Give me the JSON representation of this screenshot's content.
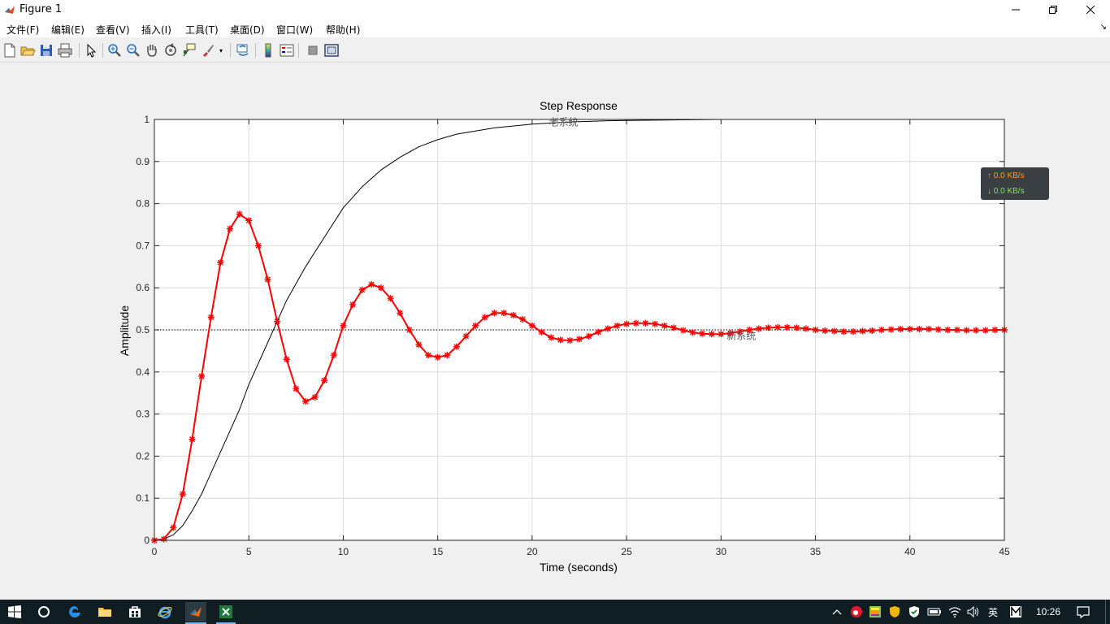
{
  "window": {
    "title": "Figure 1",
    "controls": {
      "minimize": "minimize-icon",
      "restore": "restore-icon",
      "close": "close-icon"
    }
  },
  "menu": {
    "items": [
      "文件(F)",
      "编辑(E)",
      "查看(V)",
      "插入(I)",
      "工具(T)",
      "桌面(D)",
      "窗口(W)",
      "帮助(H)"
    ]
  },
  "toolbar": {
    "icons": [
      "new-figure-icon",
      "open-file-icon",
      "save-icon",
      "print-icon",
      "pointer-icon",
      "zoom-in-icon",
      "zoom-out-icon",
      "pan-hand-icon",
      "rotate-3d-icon",
      "data-cursor-icon",
      "brush-icon",
      "link-plot-icon",
      "colorbar-icon",
      "legend-icon",
      "hide-plot-tools-icon",
      "show-plot-tools-icon"
    ]
  },
  "chart_data": {
    "type": "line",
    "title": "Step Response",
    "xlabel": "Time (seconds)",
    "ylabel": "Amplitude",
    "xlim": [
      0,
      45
    ],
    "ylim": [
      0,
      1
    ],
    "xticks": [
      0,
      5,
      10,
      15,
      20,
      25,
      30,
      35,
      40,
      45
    ],
    "yticks": [
      0,
      0.1,
      0.2,
      0.3,
      0.4,
      0.5,
      0.6,
      0.7,
      0.8,
      0.9,
      1
    ],
    "grid": true,
    "reference_lines": [
      1.0,
      0.5
    ],
    "series": [
      {
        "name": "老系统",
        "color": "#000000",
        "marker": "none",
        "x": [
          0,
          0.5,
          1,
          1.5,
          2,
          2.5,
          3,
          3.5,
          4,
          4.5,
          5,
          6,
          7,
          8,
          9,
          10,
          11,
          12,
          13,
          14,
          15,
          16,
          18,
          20,
          22,
          24,
          26,
          28,
          30,
          35,
          40,
          45
        ],
        "y": [
          0,
          0.003,
          0.013,
          0.035,
          0.07,
          0.11,
          0.16,
          0.21,
          0.26,
          0.31,
          0.37,
          0.47,
          0.57,
          0.65,
          0.72,
          0.79,
          0.84,
          0.88,
          0.91,
          0.935,
          0.952,
          0.965,
          0.98,
          0.989,
          0.994,
          0.997,
          0.998,
          0.999,
          1.0,
          1.0,
          1.0,
          1.0
        ]
      },
      {
        "name": "新系统",
        "color": "#ff0000",
        "marker": "*",
        "x": [
          0,
          0.5,
          1,
          1.5,
          2,
          2.5,
          3,
          3.5,
          4,
          4.5,
          5,
          5.5,
          6,
          6.5,
          7,
          7.5,
          8,
          8.5,
          9,
          9.5,
          10,
          10.5,
          11,
          11.5,
          12,
          12.5,
          13,
          13.5,
          14,
          14.5,
          15,
          15.5,
          16,
          16.5,
          17,
          17.5,
          18,
          18.5,
          19,
          19.5,
          20,
          20.5,
          21,
          21.5,
          22,
          22.5,
          23,
          23.5,
          24,
          24.5,
          25,
          25.5,
          26,
          26.5,
          27,
          27.5,
          28,
          28.5,
          29,
          29.5,
          30,
          30.5,
          31,
          31.5,
          32,
          32.5,
          33,
          33.5,
          34,
          34.5,
          35,
          35.5,
          36,
          36.5,
          37,
          37.5,
          38,
          38.5,
          39,
          39.5,
          40,
          40.5,
          41,
          41.5,
          42,
          42.5,
          43,
          43.5,
          44,
          44.5,
          45
        ],
        "y": [
          0,
          0.003,
          0.03,
          0.11,
          0.24,
          0.39,
          0.53,
          0.66,
          0.74,
          0.775,
          0.76,
          0.7,
          0.62,
          0.52,
          0.43,
          0.36,
          0.33,
          0.34,
          0.38,
          0.44,
          0.51,
          0.56,
          0.595,
          0.608,
          0.6,
          0.575,
          0.54,
          0.5,
          0.465,
          0.44,
          0.435,
          0.44,
          0.46,
          0.485,
          0.51,
          0.53,
          0.54,
          0.54,
          0.535,
          0.525,
          0.51,
          0.495,
          0.482,
          0.476,
          0.475,
          0.478,
          0.485,
          0.495,
          0.503,
          0.51,
          0.514,
          0.516,
          0.516,
          0.514,
          0.51,
          0.505,
          0.499,
          0.494,
          0.491,
          0.49,
          0.49,
          0.492,
          0.496,
          0.5,
          0.503,
          0.505,
          0.506,
          0.506,
          0.505,
          0.503,
          0.5,
          0.498,
          0.497,
          0.496,
          0.496,
          0.497,
          0.498,
          0.5,
          0.501,
          0.502,
          0.502,
          0.502,
          0.502,
          0.501,
          0.5,
          0.5,
          0.499,
          0.499,
          0.499,
          0.5,
          0.5
        ]
      }
    ],
    "annotations": [
      {
        "text": "老系统",
        "x": 20.9,
        "y": 0.995
      },
      {
        "text": "新系统",
        "x": 30.3,
        "y": 0.487
      }
    ]
  },
  "netmon": {
    "upload": "0.0 KB/s",
    "download": "0.0 KB/s",
    "upload_color": "#ff9a2a",
    "download_color": "#8ee44a"
  },
  "taskbar": {
    "items": [
      "windows-start-icon",
      "cortana-icon",
      "edge-icon",
      "file-explorer-icon",
      "store-icon",
      "ie-icon",
      "matlab-icon",
      "excel-icon"
    ],
    "tray": {
      "ime": "英",
      "clock": "10:26"
    }
  }
}
